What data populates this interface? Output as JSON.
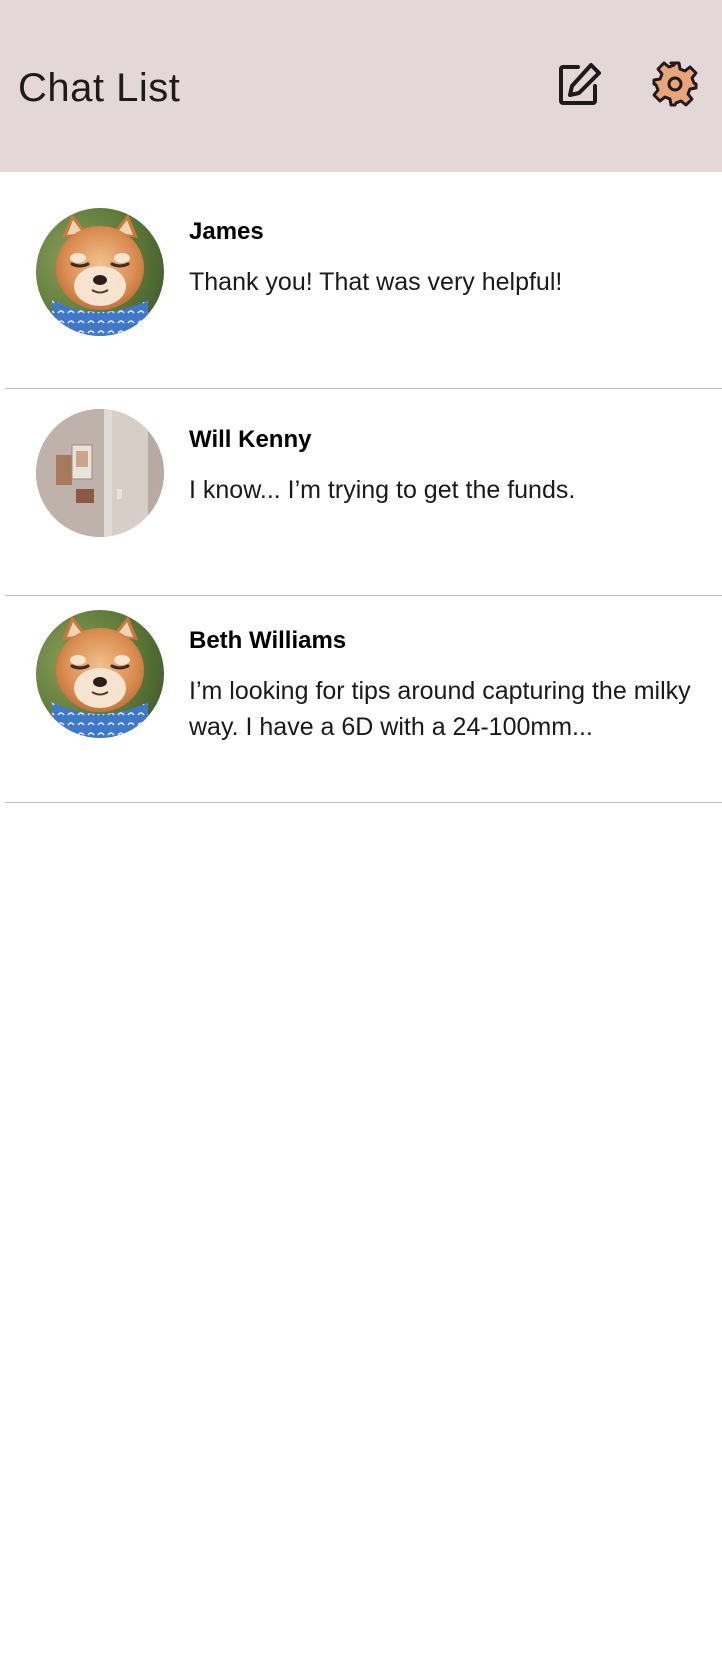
{
  "app_bar": {
    "title": "Chat List",
    "background": "#e4d7d8",
    "actions": [
      {
        "icon": "compose-icon",
        "label": "New chat"
      },
      {
        "icon": "gear-icon",
        "label": "Settings"
      }
    ]
  },
  "chats": [
    {
      "name": "James",
      "message": "Thank you! That was very helpful!",
      "avatar": "shiba-dog-avatar"
    },
    {
      "name": "Will Kenny",
      "message": "I know... I’m trying to get the funds.",
      "avatar": "door-wall-avatar"
    },
    {
      "name": "Beth Williams",
      "message": "I’m looking for tips around capturing the milky way. I have a 6D with a 24-100mm...",
      "avatar": "shiba-dog-avatar"
    }
  ],
  "colors": {
    "accent_gear": "#e8a57a",
    "divider": "#c4bdbd"
  }
}
